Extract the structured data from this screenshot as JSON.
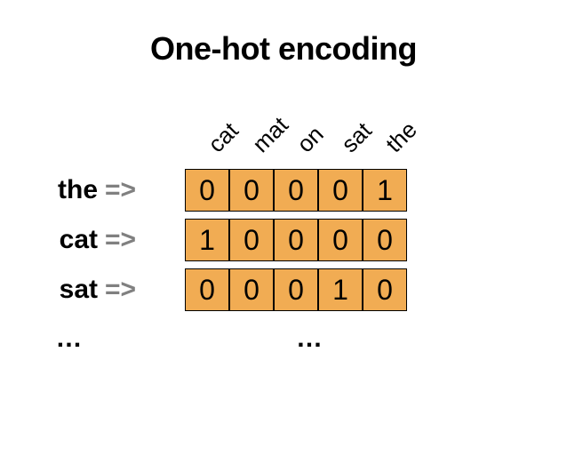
{
  "title": "One-hot encoding",
  "columns": [
    "cat",
    "mat",
    "on",
    "sat",
    "the"
  ],
  "rows": [
    {
      "word": "the",
      "arrow": "=>",
      "values": [
        0,
        0,
        0,
        0,
        1
      ]
    },
    {
      "word": "cat",
      "arrow": "=>",
      "values": [
        1,
        0,
        0,
        0,
        0
      ]
    },
    {
      "word": "sat",
      "arrow": "=>",
      "values": [
        0,
        0,
        0,
        1,
        0
      ]
    }
  ],
  "ellipsis": "…",
  "chart_data": {
    "type": "table",
    "title": "One-hot encoding",
    "columns": [
      "cat",
      "mat",
      "on",
      "sat",
      "the"
    ],
    "series": [
      {
        "name": "the",
        "values": [
          0,
          0,
          0,
          0,
          1
        ]
      },
      {
        "name": "cat",
        "values": [
          1,
          0,
          0,
          0,
          0
        ]
      },
      {
        "name": "sat",
        "values": [
          0,
          0,
          0,
          1,
          0
        ]
      }
    ]
  }
}
